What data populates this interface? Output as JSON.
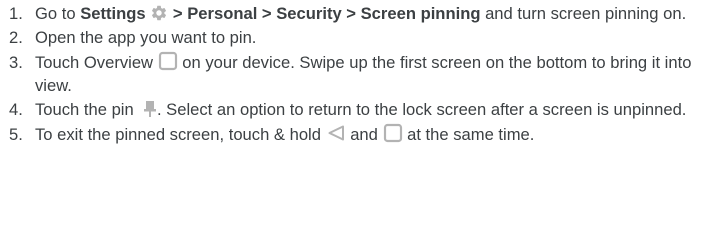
{
  "steps": [
    {
      "num": "1.",
      "t1": "Go to ",
      "settings": "Settings",
      "path": " > Personal > Security > Screen pinning",
      "t2": " and turn screen pinning on.",
      "icon": "gear-icon"
    },
    {
      "num": "2.",
      "text": "Open the app you want to pin."
    },
    {
      "num": "3.",
      "t1": "Touch Overview ",
      "t2": " on your device. Swipe up the first screen on the bottom to bring it into view.",
      "icon": "overview-square-icon"
    },
    {
      "num": "4.",
      "t1": "Touch the pin ",
      "t2": ". Select an option to return to the lock screen after a screen is unpinned.",
      "icon": "pin-icon"
    },
    {
      "num": "5.",
      "t1": "To exit the pinned screen, touch & hold ",
      "t2": " and ",
      "t3": " at the same time.",
      "icons": [
        "back-triangle-icon",
        "overview-square-icon"
      ]
    }
  ],
  "colors": {
    "text": "#3c4043",
    "icon": "#b3b3b3"
  }
}
